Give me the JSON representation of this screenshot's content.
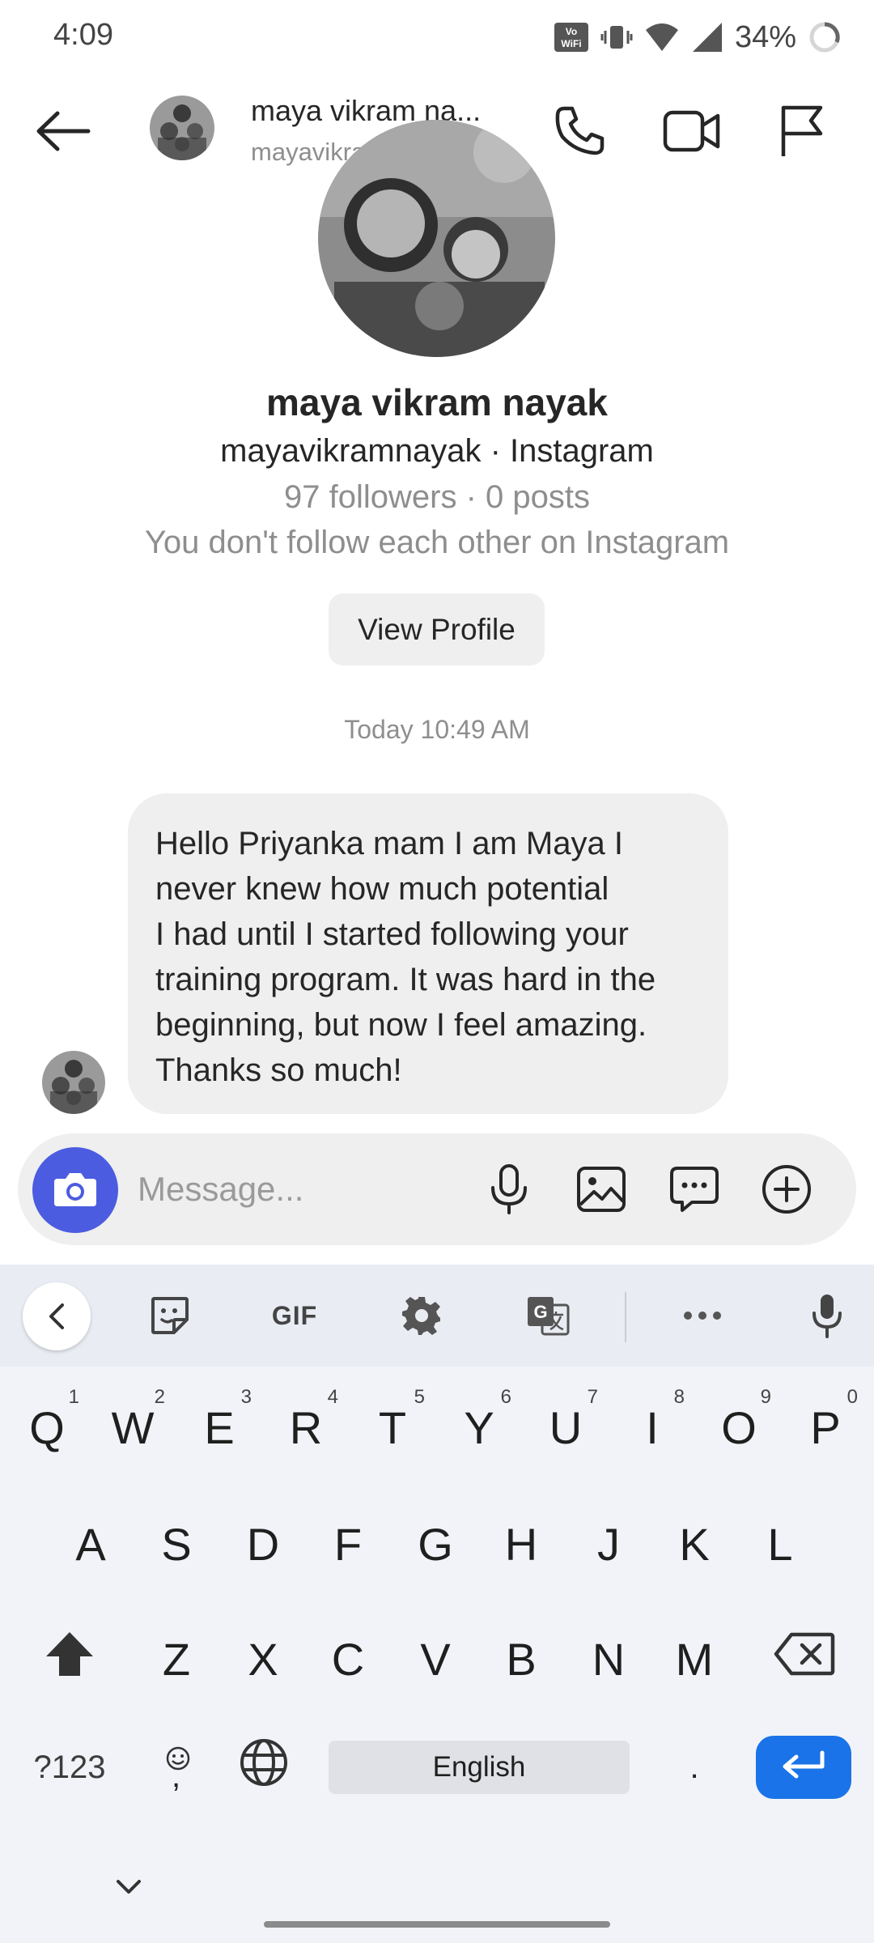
{
  "status_bar": {
    "time": "4:09",
    "battery": "34%",
    "icons": [
      "vowifi-icon",
      "vibrate-icon",
      "wifi-icon",
      "cell-signal-icon",
      "battery-ring-icon"
    ]
  },
  "header": {
    "name": "maya vikram na...",
    "username": "mayavikramnayak",
    "icons": [
      "back-arrow-icon",
      "phone-call-icon",
      "video-call-icon",
      "report-flag-icon"
    ]
  },
  "profile": {
    "name": "maya vikram nayak",
    "subtitle": "mayavikramnayak · Instagram",
    "stats": "97 followers · 0 posts",
    "follow_status": "You don't follow each other on Instagram",
    "view_profile_label": "View Profile"
  },
  "thread": {
    "timestamp": "Today 10:49 AM",
    "messages": [
      {
        "lines": [
          "Hello Priyanka mam I am Maya I",
          "never knew how much potential",
          "I had until I started following your",
          "training program. It was hard in the",
          "beginning, but now I feel amazing.",
          "Thanks so much!"
        ]
      }
    ]
  },
  "composer": {
    "placeholder": "Message...",
    "icons": [
      "camera-icon",
      "microphone-icon",
      "gallery-icon",
      "sticker-chat-icon",
      "add-circle-icon"
    ]
  },
  "keyboard": {
    "toolbar_icons": [
      "collapse-left-icon",
      "sticker-icon",
      "gif-icon",
      "settings-gear-icon",
      "translate-icon",
      "more-dots-icon",
      "voice-mic-icon"
    ],
    "gif_label": "GIF",
    "row1": [
      {
        "key": "Q",
        "hint": "1"
      },
      {
        "key": "W",
        "hint": "2"
      },
      {
        "key": "E",
        "hint": "3"
      },
      {
        "key": "R",
        "hint": "4"
      },
      {
        "key": "T",
        "hint": "5"
      },
      {
        "key": "Y",
        "hint": "6"
      },
      {
        "key": "U",
        "hint": "7"
      },
      {
        "key": "I",
        "hint": "8"
      },
      {
        "key": "O",
        "hint": "9"
      },
      {
        "key": "P",
        "hint": "0"
      }
    ],
    "row2": [
      "A",
      "S",
      "D",
      "F",
      "G",
      "H",
      "J",
      "K",
      "L"
    ],
    "row3": [
      "Z",
      "X",
      "C",
      "V",
      "B",
      "N",
      "M"
    ],
    "symbols_label": "?123",
    "comma_label": ",",
    "space_label": "English",
    "period_label": ".",
    "accent_color": "#1a73e8",
    "camera_button_color": "#4c5ce0"
  }
}
